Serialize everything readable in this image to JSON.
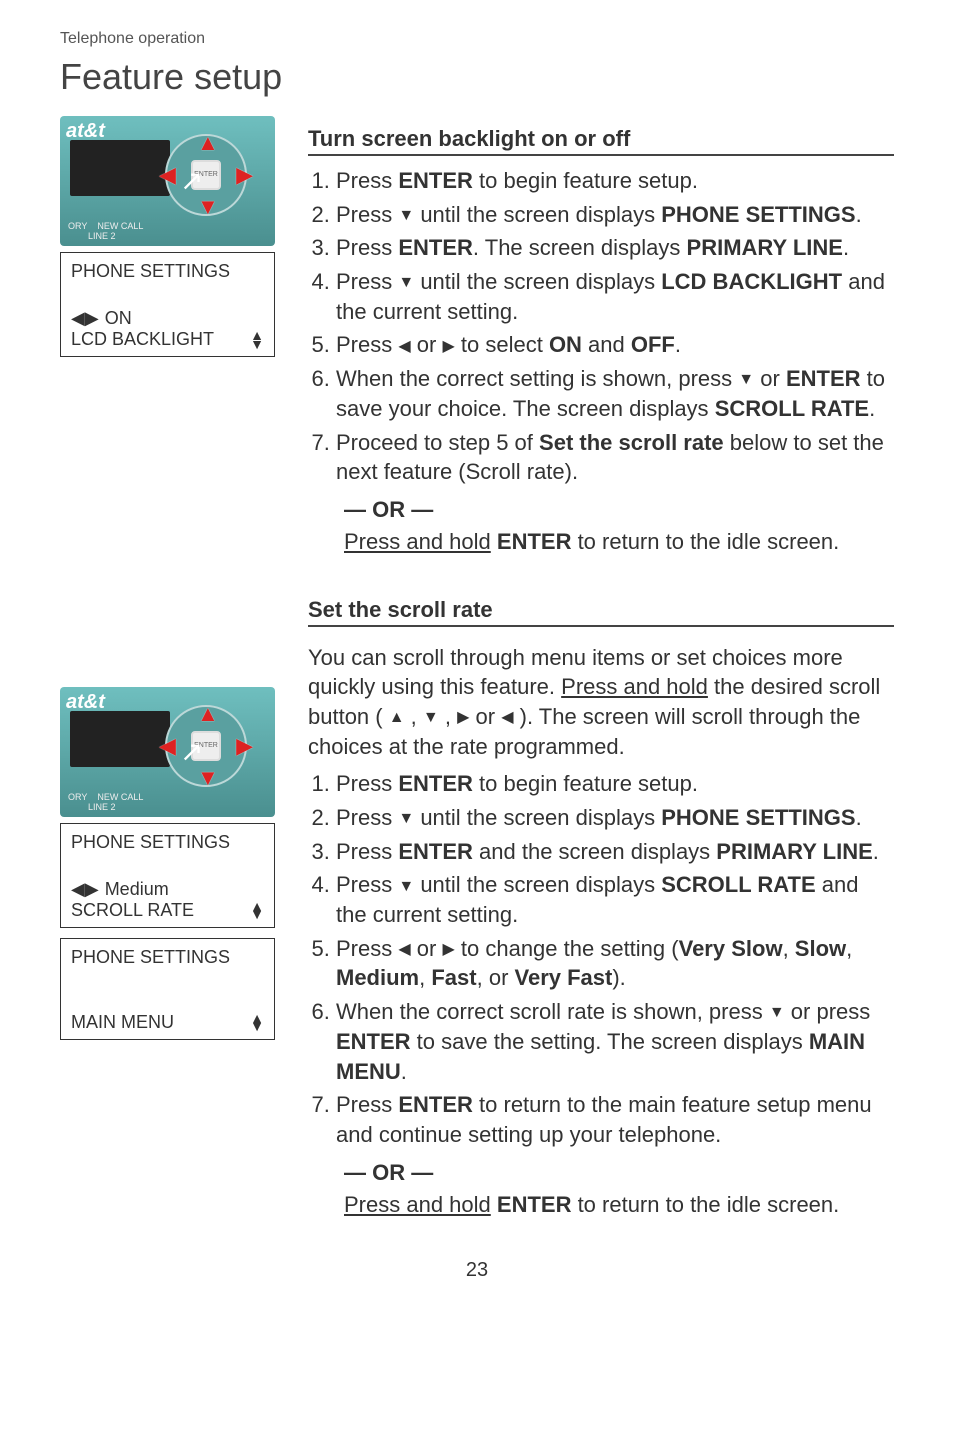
{
  "header": {
    "section": "Telephone operation",
    "title": "Feature setup"
  },
  "phone": {
    "brand": "at&t",
    "center": "ENTER",
    "strip1": "NEW CALL",
    "strip2": "LINE 2",
    "strip0": "ORY"
  },
  "lcd1": {
    "title": "PHONE SETTINGS",
    "value": "ON",
    "label": "LCD BACKLIGHT"
  },
  "lcd2": {
    "title": "PHONE SETTINGS",
    "value": "Medium",
    "label": "SCROLL RATE"
  },
  "lcd3": {
    "title": "PHONE SETTINGS",
    "label": "MAIN MENU"
  },
  "section1": {
    "heading": "Turn screen backlight on or off",
    "steps": {
      "s1a": "Press ",
      "s1b": "ENTER",
      "s1c": " to begin feature setup.",
      "s2a": "Press ",
      "s2b": " until the screen displays ",
      "s2c": "PHONE SETTINGS",
      "s2d": ".",
      "s3a": "Press ",
      "s3b": "ENTER",
      "s3c": ". The screen displays ",
      "s3d": "PRIMARY LINE",
      "s3e": ".",
      "s4a": "Press ",
      "s4b": " until the screen displays ",
      "s4c": "LCD BACKLIGHT",
      "s4d": " and the current setting.",
      "s5a": "Press ",
      "s5b": " or ",
      "s5c": " to select ",
      "s5d": "ON",
      "s5e": " and ",
      "s5f": "OFF",
      "s5g": ".",
      "s6a": "When the correct setting is shown, press ",
      "s6b": " or ",
      "s6c": "ENTER",
      "s6d": " to save your choice. The screen displays ",
      "s6e": "SCROLL RATE",
      "s6f": ".",
      "s7a": "Proceed to step 5 of ",
      "s7b": "Set the scroll rate",
      "s7c": " below to set the next feature (Scroll rate)."
    },
    "or": "— OR —",
    "after_a": "Press and hold",
    "after_b": " ",
    "after_c": "ENTER",
    "after_d": " to return to the idle screen."
  },
  "section2": {
    "heading": "Set the scroll rate",
    "intro_a": "You can scroll through menu items or set choices more quickly using this feature. ",
    "intro_b": "Press and hold",
    "intro_c": " the desired scroll button ( ",
    "intro_d": " , ",
    "intro_e": " , ",
    "intro_f": " or ",
    "intro_g": " ). The screen will scroll through the choices at the rate programmed.",
    "steps": {
      "s1a": "Press ",
      "s1b": "ENTER",
      "s1c": " to begin feature setup.",
      "s2a": "Press ",
      "s2b": " until the screen displays ",
      "s2c": "PHONE SETTINGS",
      "s2d": ".",
      "s3a": "Press ",
      "s3b": "ENTER",
      "s3c": " and the screen displays ",
      "s3d": "PRIMARY LINE",
      "s3e": ".",
      "s4a": "Press ",
      "s4b": " until the screen displays ",
      "s4c": "SCROLL RATE",
      "s4d": " and the current setting.",
      "s5a": "Press ",
      "s5b": " or ",
      "s5c": " to change the setting (",
      "s5d": "Very Slow",
      "s5e": ", ",
      "s5f": "Slow",
      "s5g": ", ",
      "s5h": "Medium",
      "s5i": ", ",
      "s5j": "Fast",
      "s5k": ", or ",
      "s5l": "Very Fast",
      "s5m": ").",
      "s6a": "When the correct scroll rate is shown, press ",
      "s6b": " or press ",
      "s6c": "ENTER",
      "s6d": " to save the setting. The screen displays ",
      "s6e": "MAIN MENU",
      "s6f": ".",
      "s7a": "Press ",
      "s7b": "ENTER",
      "s7c": " to return to the main feature setup menu and continue setting up your telephone."
    },
    "or": "— OR —",
    "after_a": "Press and hold",
    "after_b": " ",
    "after_c": "ENTER",
    "after_d": " to return to the idle screen."
  },
  "page_number": "23",
  "glyph": {
    "up": "▲",
    "down": "▼",
    "left": "◀",
    "right": "▶",
    "lr": "◀▶",
    "ud": "▲▼",
    "ud_stack": "▲\n▼"
  }
}
